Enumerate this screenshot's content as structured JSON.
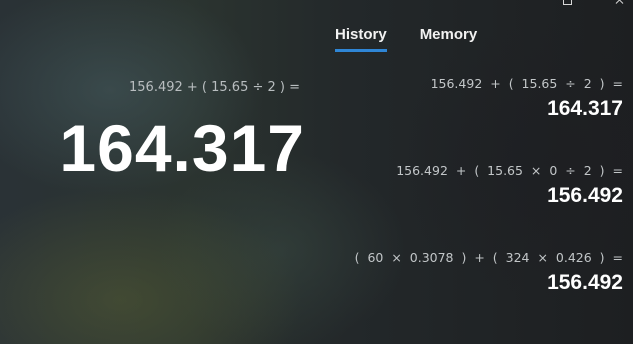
{
  "window": {
    "controls": [
      "restore-icon",
      "close-icon"
    ]
  },
  "display": {
    "expression": "156.492 + ( 15.65 ÷ 2 ) =",
    "result": "164.317"
  },
  "tabs": [
    {
      "label": "History",
      "active": true
    },
    {
      "label": "Memory",
      "active": false
    }
  ],
  "history": [
    {
      "expression": "156.492  +  ( 15.65  ÷  2 )  =",
      "result": "164.317"
    },
    {
      "expression": "156.492  +  ( 15.65  ×  0  ÷  2 )  =",
      "result": "156.492"
    },
    {
      "expression": "( 60  ×  0.3078 )  +  ( 324  ×  0.426 )  =",
      "result": "156.492"
    }
  ],
  "colors": {
    "accent": "#2f86d6",
    "text_primary": "#ffffff",
    "text_secondary": "#b9bec0"
  }
}
